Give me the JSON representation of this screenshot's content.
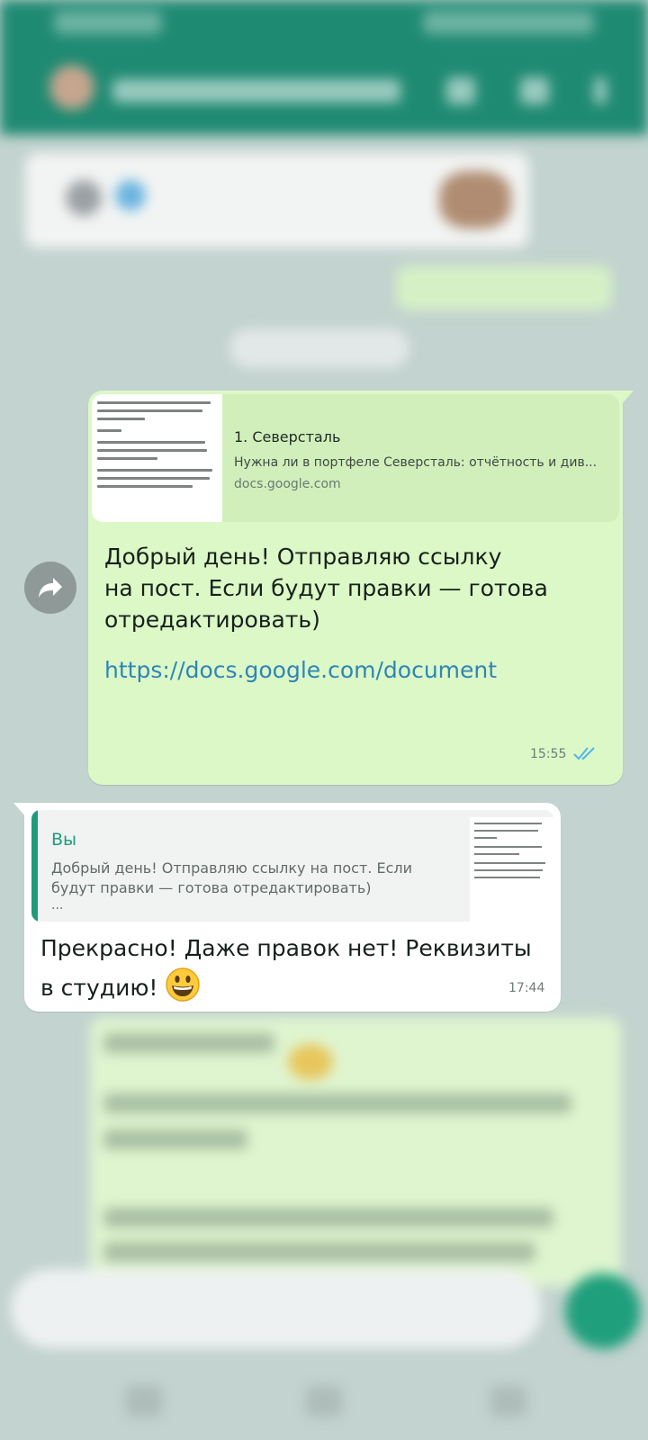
{
  "link_preview": {
    "title": "1. Северсталь",
    "description": "Нужна ли в портфеле Северсталь: отчётность и див...",
    "domain": "docs.google.com"
  },
  "outgoing_message": {
    "text": "Добрый день! Отправляю ссылку\nна пост. Если будут правки — готова\nотредактировать)",
    "link": "https://docs.google.com/document",
    "time": "15:55",
    "status": "read"
  },
  "incoming_message": {
    "quote": {
      "author": "Вы",
      "text": "Добрый день! Отправляю ссылку на пост. Если будут правки — готова отредактировать)",
      "ellipsis": "..."
    },
    "text": "Прекрасно! Даже правок нет! Реквизиты в студию!",
    "emoji": "grinning-face",
    "time": "17:44"
  },
  "colors": {
    "outgoing_bubble": "#dcf8c6",
    "incoming_bubble": "#ffffff",
    "accent": "#1e9c7b",
    "link": "#2e86b8",
    "read_ticks": "#4fb6ec"
  }
}
